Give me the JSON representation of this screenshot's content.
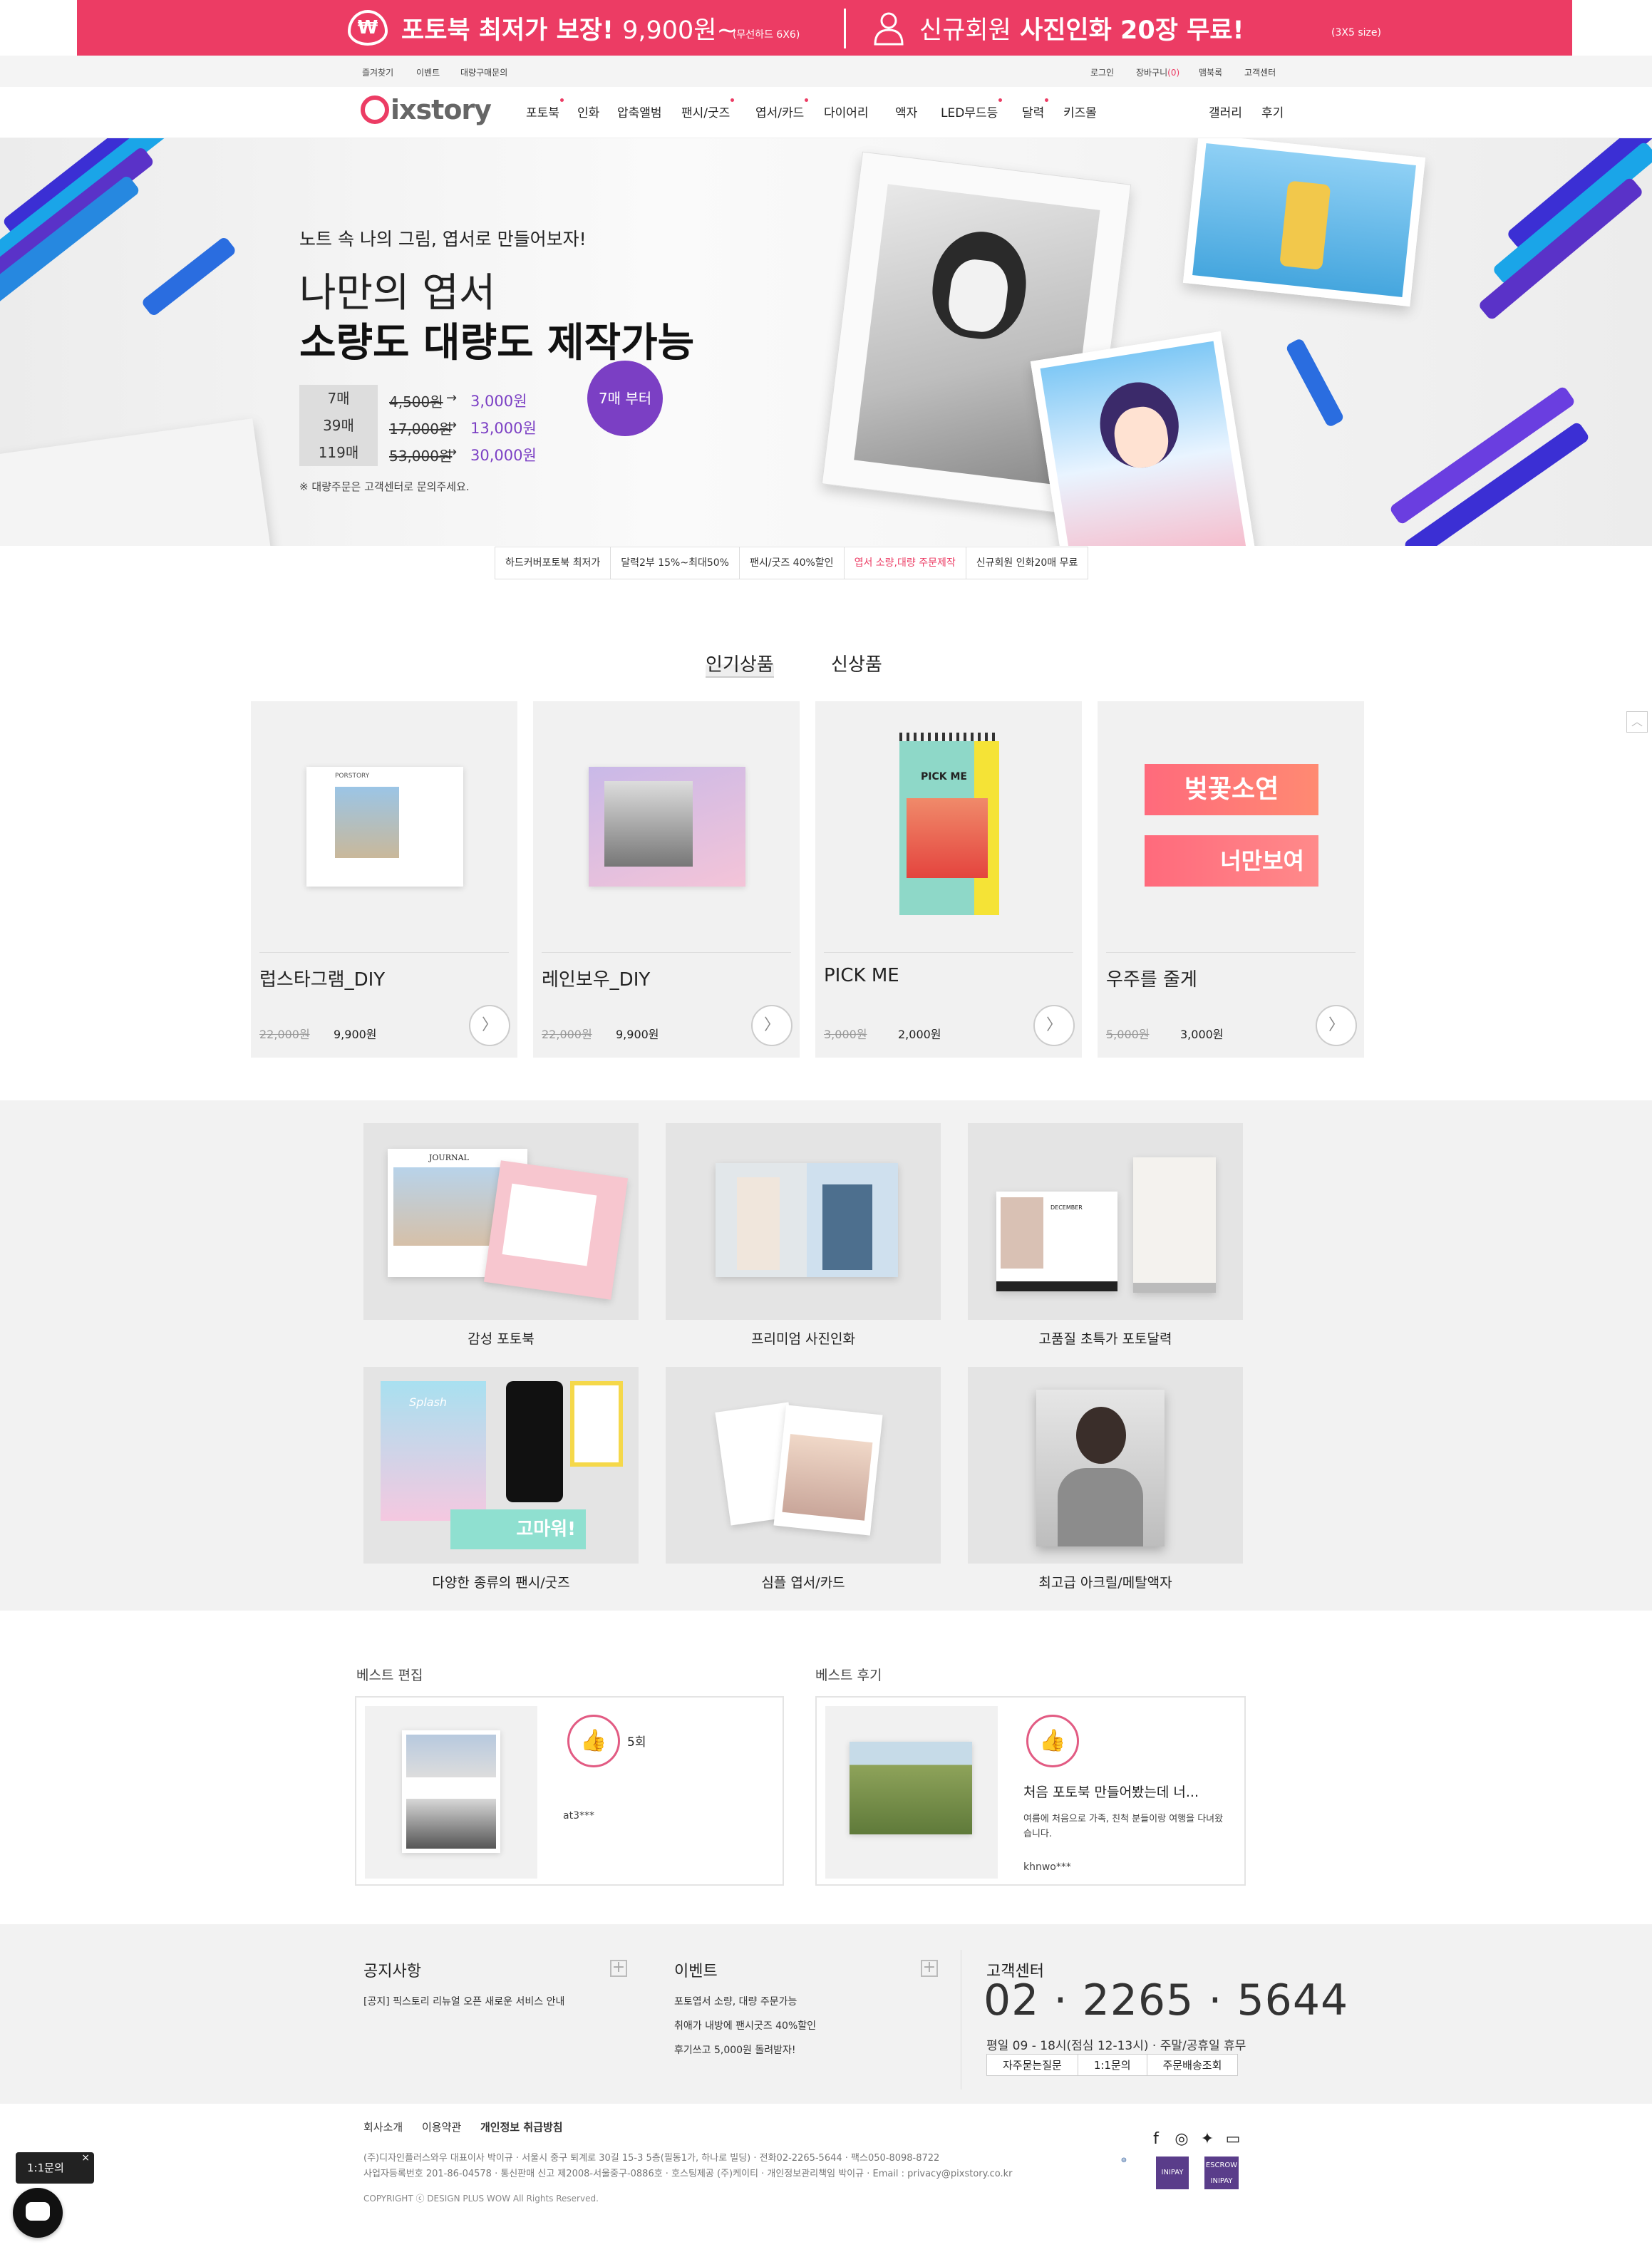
{
  "top_banner": {
    "won_symbol": "₩",
    "photobook_label": "포토북 최저가 보장!",
    "photobook_price": "9,900원~",
    "photobook_note": "(무선하드 6X6)",
    "member_label_light": "신규회원",
    "member_label_bold": "사진인화 20장 무료!",
    "member_note": "(3X5 size)",
    "bg_color": "#ec3c64"
  },
  "util_bar": {
    "left": [
      "즐겨찾기",
      "이벤트",
      "대량구매문의"
    ],
    "login": "로그인",
    "cart": "장바구니",
    "cart_count": "(0)",
    "sitemap": "맴북록",
    "customer_center": "고객센터"
  },
  "nav": {
    "logo": "ixstory",
    "items": [
      "포토북",
      "인화",
      "압축앨범",
      "팬시/굿즈",
      "엽서/카드",
      "다이어리",
      "액자",
      "LED무드등",
      "달력",
      "키즈몰"
    ],
    "right": [
      "갤러리",
      "후기"
    ]
  },
  "hero": {
    "subtitle": "노트 속 나의 그림, 엽서로 만들어보자!",
    "title_line1": "나만의 엽서",
    "title_line2": "소량도 대량도 제작가능",
    "prices": [
      {
        "qty": "7매",
        "old": "4,500원",
        "new": "3,000원"
      },
      {
        "qty": "39매",
        "old": "17,000원",
        "new": "13,000원"
      },
      {
        "qty": "119매",
        "old": "53,000원",
        "new": "30,000원"
      }
    ],
    "arrow": "→",
    "note": "※ 대량주문은 고객센터로 문의주세요.",
    "badge": "7매 부터",
    "accent_color": "#7b3fc4"
  },
  "promo_chips": [
    "하드커버포토북 최저가",
    "달력2부 15%~최대50%",
    "팬시/굿즈 40%할인",
    "엽서 소량,대량 주문제작",
    "신규회원 인화20매 무료"
  ],
  "tabs": [
    "인기상품",
    "신상품"
  ],
  "products": [
    {
      "name": "럽스타그램_DIY",
      "old_price": "22,000원",
      "price": "9,900원"
    },
    {
      "name": "레인보우_DIY",
      "old_price": "22,000원",
      "price": "9,900원"
    },
    {
      "name": "PICK ME",
      "old_price": "3,000원",
      "price": "2,000원"
    },
    {
      "name": "우주를 줄게",
      "old_price": "5,000원",
      "price": "3,000원"
    }
  ],
  "product_images": {
    "card1_tag": "PORSTORY",
    "card3_title": "PICK ME",
    "card4_line1": "벚꽃소연",
    "card4_line2": "너만보여"
  },
  "categories": [
    "감성 포토북",
    "프리미엄 사진인화",
    "고품질 초특가 포토달력",
    "다양한 종류의 팬시/굿즈",
    "심플 엽서/카드",
    "최고급 아크릴/메탈액자"
  ],
  "category_images": {
    "journal": "JOURNAL",
    "december": "DECEMBER",
    "splash": "Splash",
    "thanks": "고마워!"
  },
  "best_edit": {
    "title": "베스트 편집",
    "likes": "5회",
    "user": "at3***"
  },
  "best_review": {
    "title": "베스트 후기",
    "headline": "처음 포토북 만들어봤는데 너...",
    "body": "여름에 처음으로 가족, 친척 분들이랑 여행을 다녀왔습니다.",
    "user": "khnwo***"
  },
  "notice": {
    "title": "공지사항",
    "items": [
      "[공지] 픽스토리 리뉴얼 오픈 새로운 서비스 안내"
    ]
  },
  "events": {
    "title": "이벤트",
    "items": [
      "포토엽서 소량, 대량 주문가능",
      "취애가 내방에 팬시굿즈 40%할인",
      "후기쓰고 5,000원 돌려받자!"
    ]
  },
  "customer_center": {
    "title": "고객센터",
    "phone": "02 · 2265 · 5644",
    "hours": "평일 09 - 18시(점심 12-13시) · 주말/공휴일 휴무",
    "buttons": [
      "자주묻는질문",
      "1:1문의",
      "주문배송조회"
    ]
  },
  "footer": {
    "links": [
      "회사소개",
      "이용약관",
      "개인정보 취급방침"
    ],
    "address_line1": "(주)디자인플러스와우 대표이사 박이규 · 서울시 중구 퇴계로 30길 15-3 5층(필동1가, 하나로 빌딩) · 전화02-2265-5644 · 팩스050-8098-8722",
    "address_line2": "사업자등록번호 201-86-04578 · 통신판매 신고 제2008-서울중구-0886호 · 호스팅제공 (주)케이티 · 개인정보관리책임 박이규 · Email : privacy@pixstory.co.kr",
    "copyright": "COPYRIGHT ⓒ DESIGN PLUS WOW All Rights Reserved.",
    "certs": [
      "INIPAY",
      "ESCROW INIPAY"
    ]
  },
  "chat": {
    "label": "1:1문의",
    "close": "×"
  },
  "scroll_top": "︿"
}
